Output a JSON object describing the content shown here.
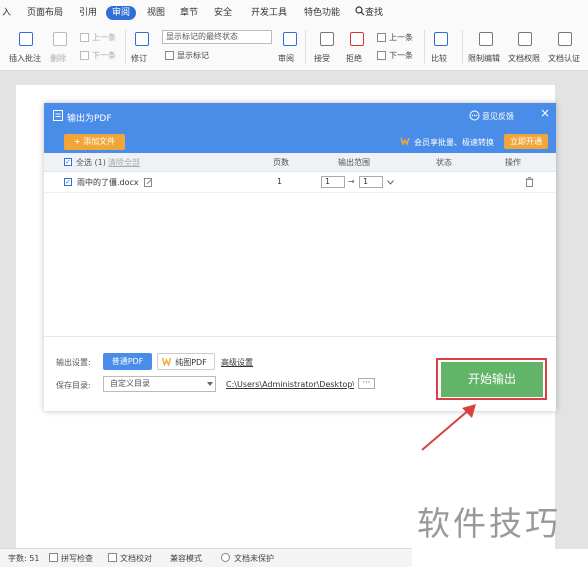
{
  "ribbon": {
    "tabs": [
      "入",
      "页面布局",
      "引用",
      "审阅",
      "视图",
      "章节",
      "安全",
      "开发工具",
      "特色功能",
      "查找"
    ],
    "active_tab": "审阅",
    "tools": {
      "insert_comment": "插入批注",
      "delete": "删除",
      "prev": "上一条",
      "next": "下一条",
      "revise": "修订",
      "final_state": "显示标记的最终状态",
      "show_markup": "显示标记",
      "review": "审阅",
      "accept": "接受",
      "reject": "拒绝",
      "prev2": "上一条",
      "next2": "下一条",
      "compare": "比较",
      "restrict_edit": "限制编辑",
      "doc_permission": "文档权限",
      "doc_auth": "文档认证"
    }
  },
  "dialog": {
    "title": "输出为PDF",
    "feedback": "意见反馈",
    "close": "×",
    "add_file": "+ 添加文件",
    "vip_text": "会员享批量、极速转换",
    "vip_button": "立即开通",
    "table": {
      "select_all": "全选 (1)",
      "clear_all": "清除全部",
      "headers": [
        "页数",
        "输出范围",
        "状态",
        "操作"
      ],
      "rows": [
        {
          "filename": "雨中的了僵.docx",
          "pages": "1",
          "range_from": "1",
          "arrow": "→",
          "range_to": "1"
        }
      ]
    },
    "output_settings_label": "输出设置:",
    "normal_pdf": "普通PDF",
    "image_pdf": "纯图PDF",
    "advanced": "高级设置",
    "save_dir_label": "保存目录:",
    "save_dir_option": "自定义目录",
    "save_path": "C:\\Users\\Administrator\\Desktop\\",
    "browse": "···",
    "start_button": "开始输出"
  },
  "status_bar": {
    "word_count": "字数: 51",
    "spell_check": "拼写检查",
    "doc_proof": "文档校对",
    "compat_mode": "兼容模式",
    "doc_unprotected": "文档未保护"
  },
  "watermark": "软件技巧",
  "colors": {
    "accent": "#4a8de8",
    "start": "#62b468",
    "highlight": "#d94040",
    "orange": "#f2a63a"
  }
}
